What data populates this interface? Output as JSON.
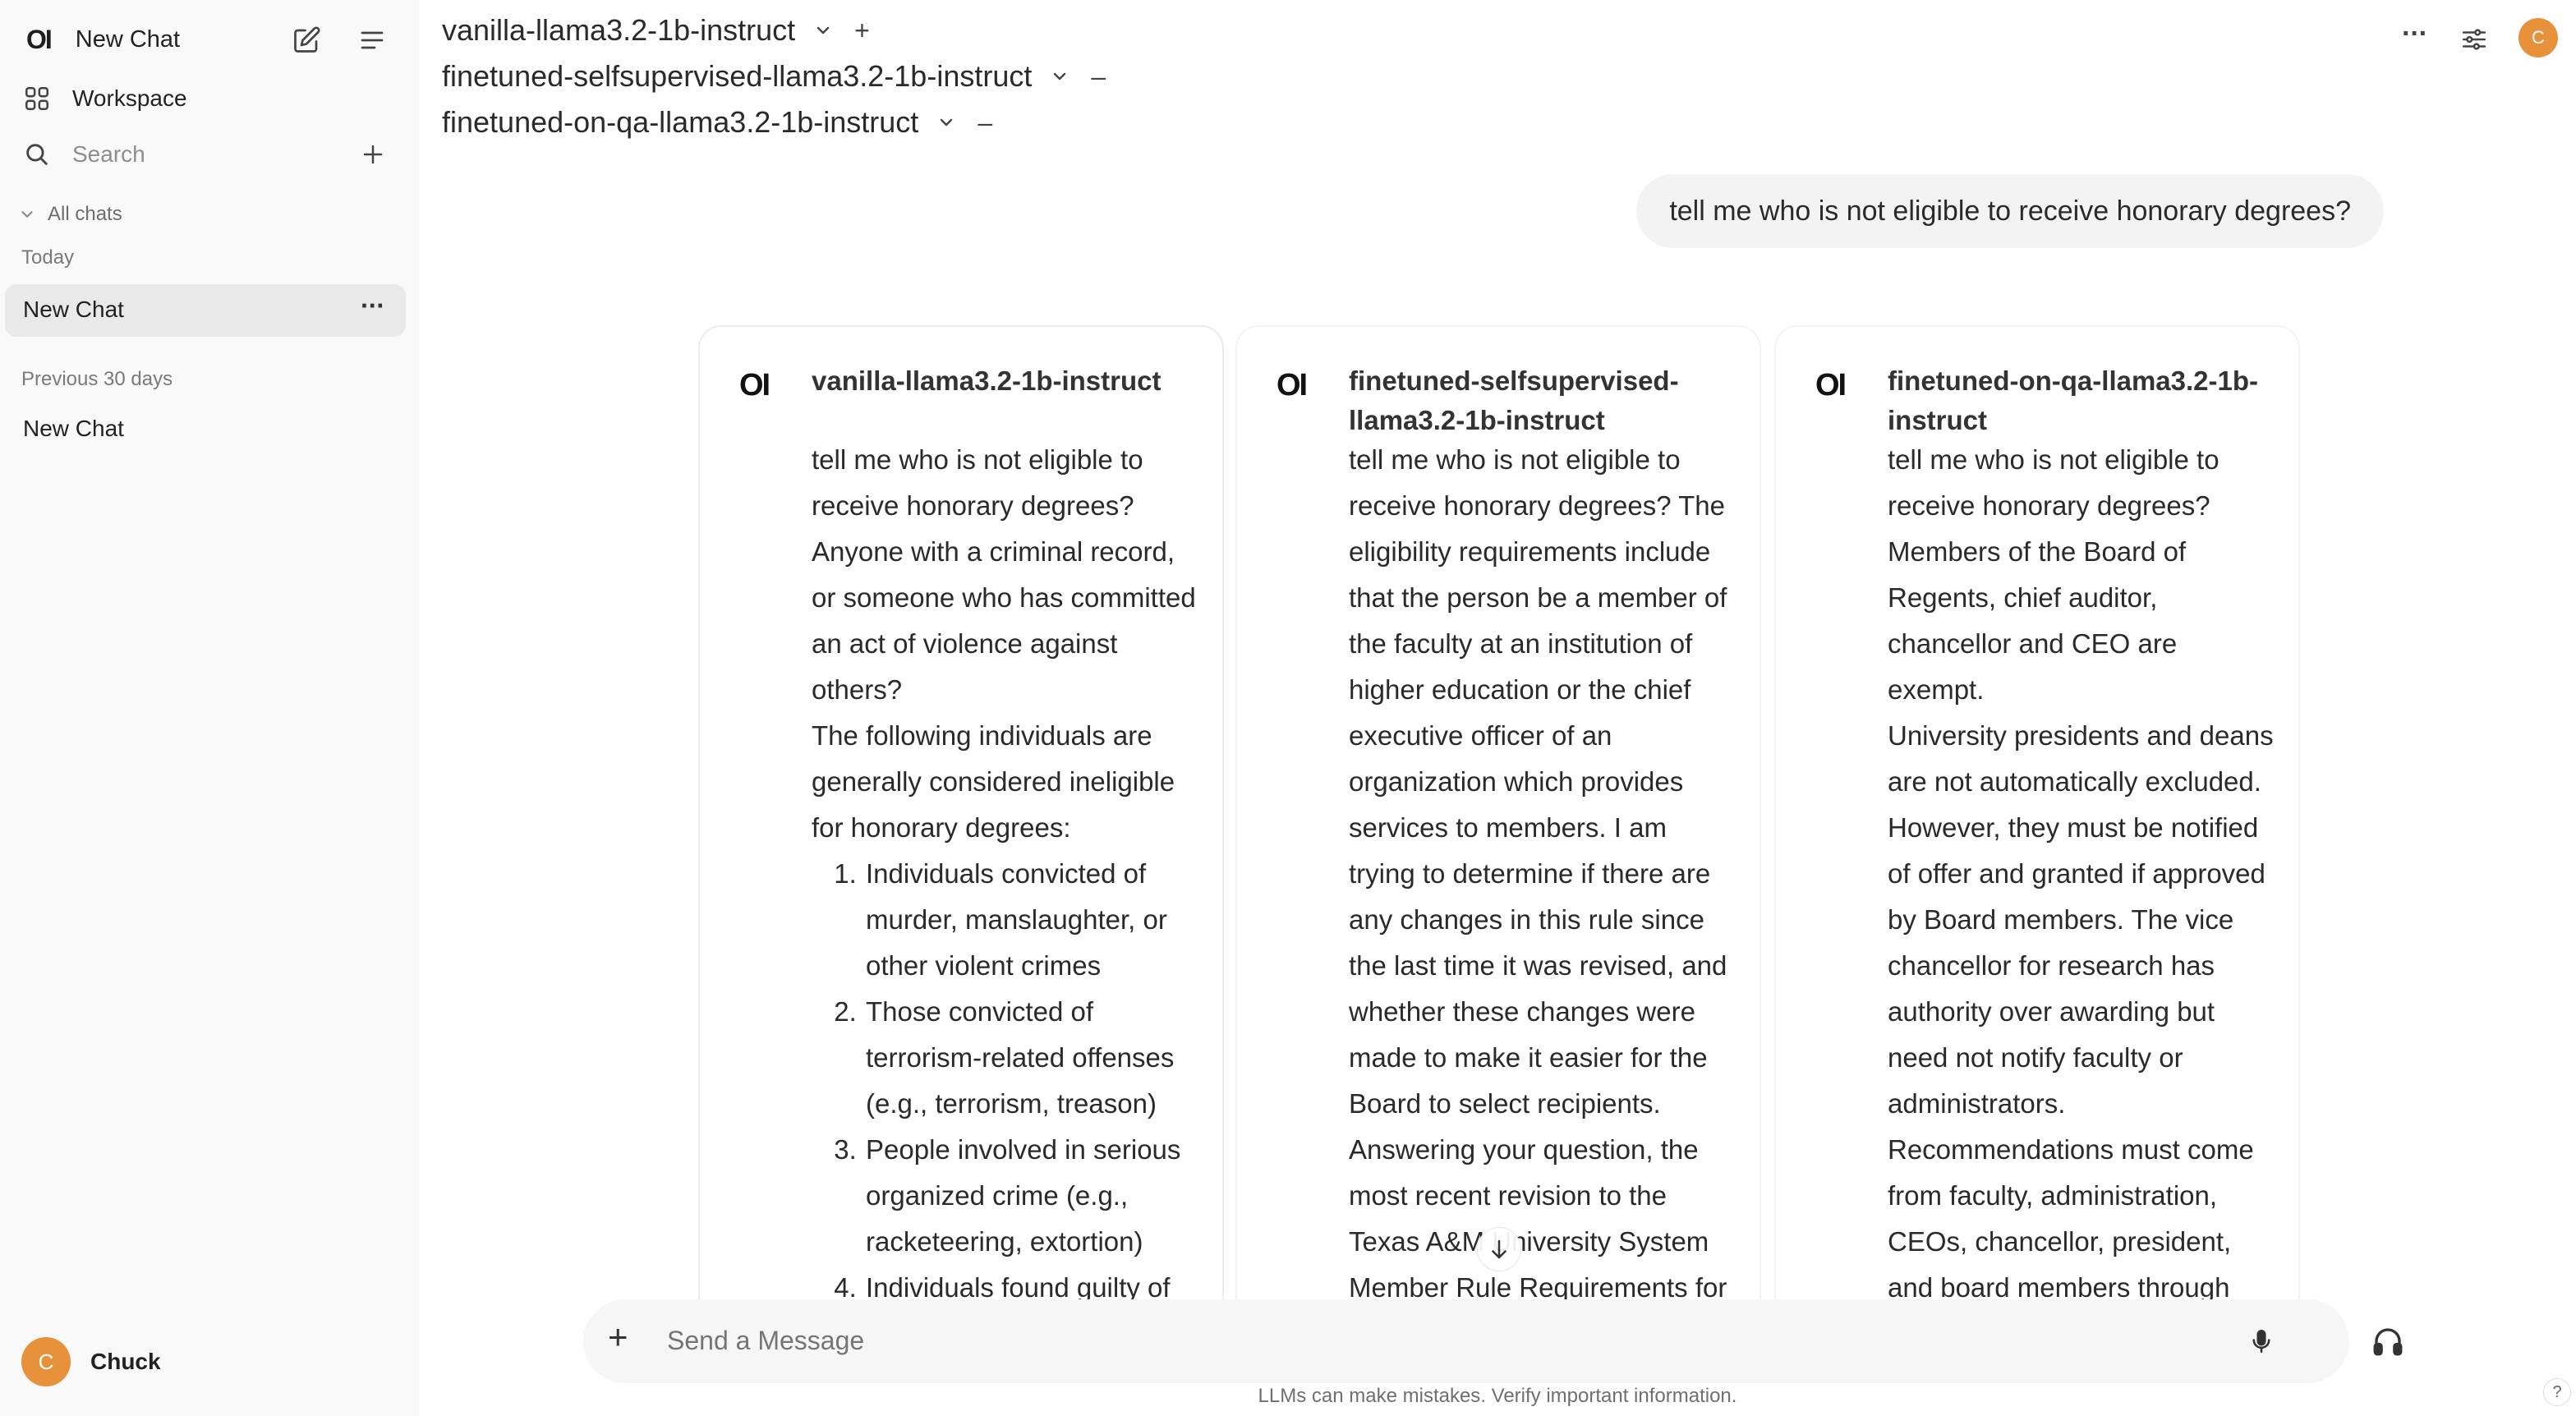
{
  "sidebar": {
    "app_logo": "OI",
    "title": "New Chat",
    "workspace": "Workspace",
    "search_placeholder": "Search",
    "all_chats": "All chats",
    "section_today": "Today",
    "today_chats": [
      "New Chat"
    ],
    "section_previous": "Previous 30 days",
    "previous_chats": [
      "New Chat"
    ],
    "user": {
      "initial": "C",
      "name": "Chuck"
    }
  },
  "header": {
    "models": [
      {
        "name": "vanilla-llama3.2-1b-instruct",
        "action": "+"
      },
      {
        "name": "finetuned-selfsupervised-llama3.2-1b-instruct",
        "action": "–"
      },
      {
        "name": "finetuned-on-qa-llama3.2-1b-instruct",
        "action": "–"
      }
    ],
    "more": "···",
    "user_initial": "C"
  },
  "user_message": "tell me who is not eligible to receive honorary degrees?",
  "responses": [
    {
      "logo": "OI",
      "model": "vanilla-llama3.2-1b-instruct",
      "paragraphs": [
        "tell me who is not eligible to receive honorary degrees? Anyone with a criminal record, or someone who has committed an act of violence against others?",
        "The following individuals are generally considered ineligible for honorary degrees:"
      ],
      "list": [
        "Individuals convicted of murder, manslaughter, or other violent crimes",
        "Those convicted of terrorism-related offenses (e.g., terrorism, treason)",
        "People involved in serious organized crime (e.g., racketeering, extortion)",
        "Individuals found guilty of"
      ]
    },
    {
      "logo": "OI",
      "model": "finetuned-selfsupervised-llama3.2-1b-instruct",
      "paragraphs": [
        "tell me who is not eligible to receive honorary degrees? The eligibility requirements include that the person be a member of the faculty at an institution of higher education or the chief executive officer of an organization which provides services to members. I am trying to determine if there are any changes in this rule since the last time it was revised, and whether these changes were made to make it easier for the Board to select recipients.",
        "Answering your question, the most recent revision to the Texas A&M University System Member Rule Requirements for"
      ],
      "list": []
    },
    {
      "logo": "OI",
      "model": "finetuned-on-qa-llama3.2-1b-instruct",
      "paragraphs": [
        "tell me who is not eligible to receive honorary degrees? Members of the Board of Regents, chief auditor, chancellor and CEO are exempt.",
        "University presidents and deans are not automatically excluded. However, they must be notified of offer and granted if approved by Board members. The vice chancellor for research has authority over awarding but need not notify faculty or administrators.",
        "Recommendations must come from faculty, administration, CEOs, chancellor, president, and board members through"
      ],
      "list": []
    }
  ],
  "composer": {
    "placeholder": "Send a Message",
    "add": "+"
  },
  "footer": "LLMs can make mistakes. Verify important information.",
  "help": "?"
}
